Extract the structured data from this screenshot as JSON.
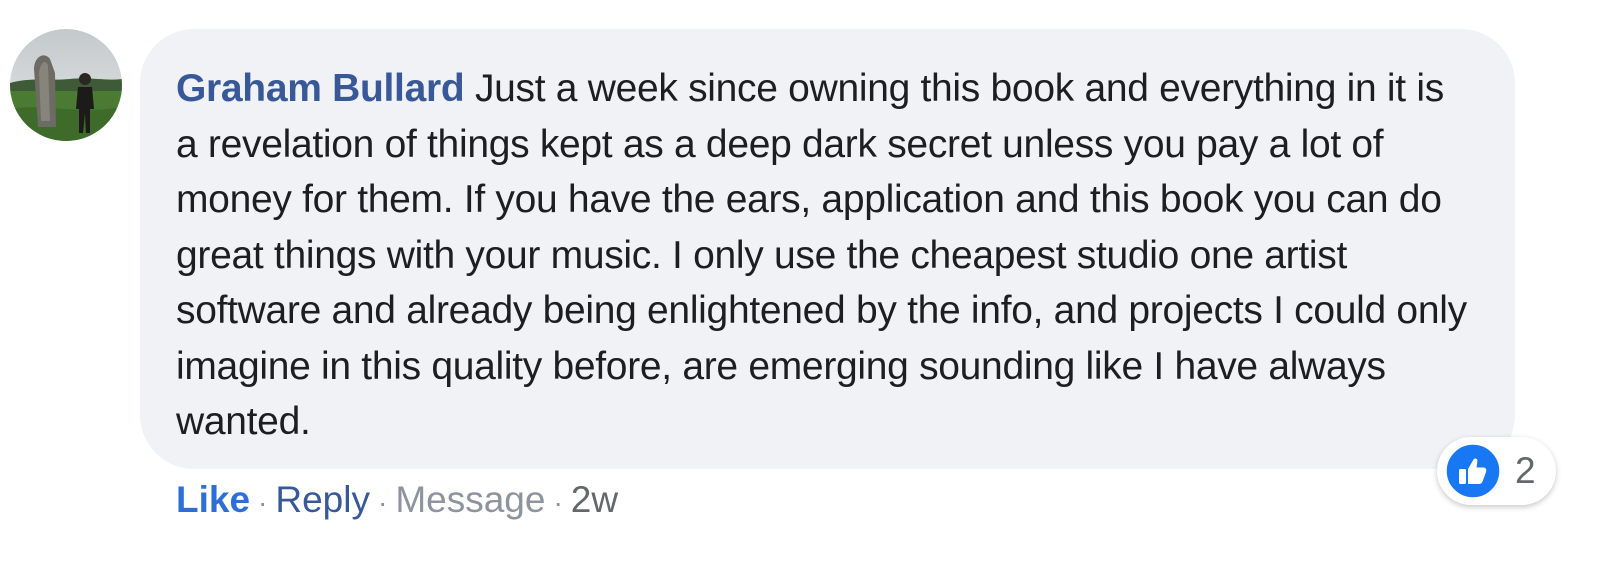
{
  "comment": {
    "author": "Graham Bullard",
    "text": "Just a week since owning this book and everything in it is a revelation of things kept as a deep dark secret unless you pay a lot of money for them. If you have the ears, application and this book you can do great things with your music. I only use the cheapest studio one artist software and already being enlightened by the info, and projects I could only imagine in this quality before, are emerging sounding like I have always wanted."
  },
  "actions": {
    "like_label": "Like",
    "reply_label": "Reply",
    "message_label": "Message",
    "separator": "·",
    "timestamp": "2w"
  },
  "reactions": {
    "icon": "thumbs-up-icon",
    "count": "2"
  },
  "colors": {
    "author_link": "#385898",
    "like_blue": "#2d6fd4",
    "bubble_bg": "#f0f2f5",
    "reaction_blue": "#1877f2"
  }
}
